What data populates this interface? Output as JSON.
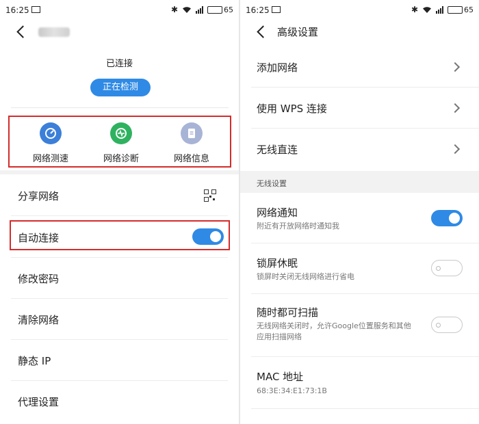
{
  "status_bar": {
    "time": "16:25",
    "battery": "65"
  },
  "left": {
    "title_blurred": true,
    "connection_status": "已连接",
    "detect_button": "正在检测",
    "tools": [
      {
        "label": "网络测速",
        "icon": "speedometer-icon",
        "color": "#3b7fd9"
      },
      {
        "label": "网络诊断",
        "icon": "pulse-icon",
        "color": "#2fb25f"
      },
      {
        "label": "网络信息",
        "icon": "document-icon",
        "color": "#a8b4d6"
      }
    ],
    "rows": [
      {
        "label": "分享网络",
        "control": "qr-code-icon"
      },
      {
        "label": "自动连接",
        "control": "toggle",
        "value": true
      },
      {
        "label": "修改密码"
      },
      {
        "label": "清除网络"
      },
      {
        "label": "静态 IP"
      },
      {
        "label": "代理设置"
      }
    ]
  },
  "right": {
    "title": "高级设置",
    "rows": [
      {
        "label": "添加网络"
      },
      {
        "label": "使用 WPS 连接"
      },
      {
        "label": "无线直连"
      }
    ],
    "section": "无线设置",
    "toggles": [
      {
        "title": "网络通知",
        "subtitle": "附近有开放网络时通知我",
        "value": true
      },
      {
        "title": "锁屏休眠",
        "subtitle": "锁屏时关闭无线网络进行省电",
        "value": false
      },
      {
        "title": "随时都可扫描",
        "subtitle_line1": "无线网络关闭时，允许Google位置服务和其他",
        "subtitle_line2": "应用扫描网络",
        "value": false
      }
    ],
    "mac": {
      "title": "MAC 地址",
      "value": "68:3E:34:E1:73:1B"
    }
  },
  "colors": {
    "accent": "#2f8ae5",
    "highlight": "#d52b2b"
  }
}
